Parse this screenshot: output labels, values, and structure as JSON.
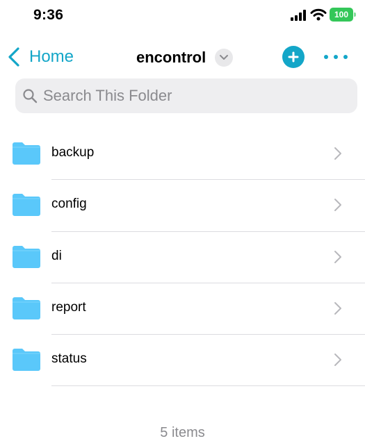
{
  "status_bar": {
    "time": "9:36",
    "battery": "100"
  },
  "nav": {
    "back_label": "Home",
    "title": "encontrol"
  },
  "search": {
    "placeholder": "Search This Folder"
  },
  "folders": [
    {
      "name": "backup"
    },
    {
      "name": "config"
    },
    {
      "name": "di"
    },
    {
      "name": "report"
    },
    {
      "name": "status"
    }
  ],
  "footer": {
    "item_count": "5 items"
  },
  "colors": {
    "accent": "#13a6c8",
    "folder": "#5ac8fa",
    "battery": "#34c759"
  },
  "icons": {
    "back": "chevron-left-icon",
    "title_menu": "chevron-down-icon",
    "add": "plus-icon",
    "more": "ellipsis-icon",
    "search": "search-icon",
    "folder": "folder-icon",
    "row": "chevron-right-icon"
  }
}
